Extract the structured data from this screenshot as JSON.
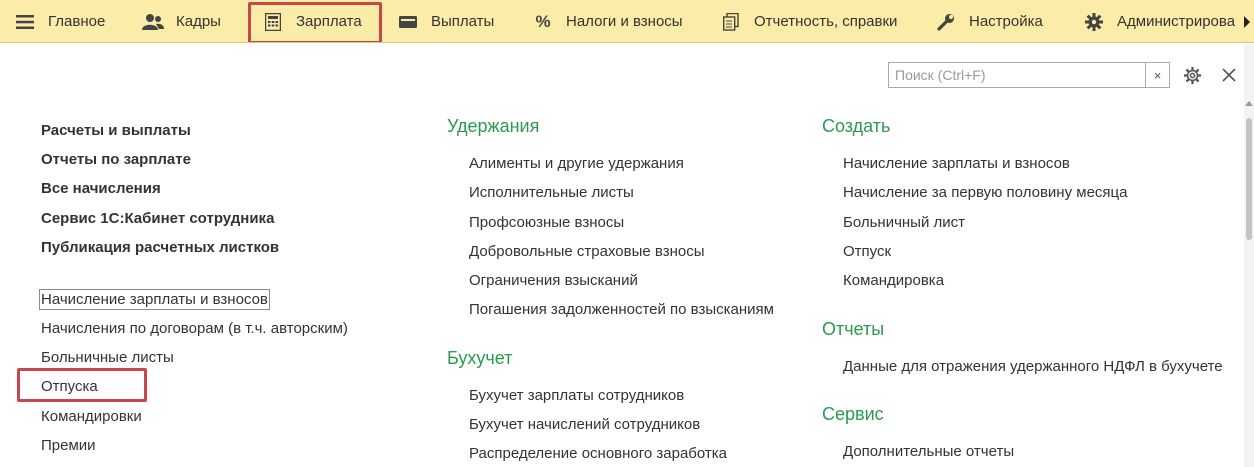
{
  "menu": {
    "tabs": [
      {
        "label": "Главное",
        "icon": "hamburger-icon"
      },
      {
        "label": "Кадры",
        "icon": "people-icon"
      },
      {
        "label": "Зарплата",
        "icon": "calculator-icon"
      },
      {
        "label": "Выплаты",
        "icon": "wallet-icon"
      },
      {
        "label": "Налоги и взносы",
        "icon": "percent-icon"
      },
      {
        "label": "Отчетность, справки",
        "icon": "documents-icon"
      },
      {
        "label": "Настройка",
        "icon": "wrench-icon"
      },
      {
        "label": "Администрирова",
        "icon": "gear-icon"
      }
    ],
    "percent_glyph": "%"
  },
  "search": {
    "placeholder": "Поиск (Ctrl+F)",
    "value": "",
    "clear_glyph": "×"
  },
  "close_glyph": "✕",
  "left": {
    "bold_links": [
      "Расчеты и выплаты",
      "Отчеты по зарплате",
      "Все начисления",
      "Сервис 1С:Кабинет сотрудника",
      "Публикация расчетных листков"
    ],
    "links": [
      "Начисление зарплаты и взносов",
      "Начисления по договорам (в т.ч. авторским)",
      "Больничные листы",
      "Отпуска",
      "Командировки",
      "Премии"
    ]
  },
  "middle": {
    "sections": [
      {
        "title": "Удержания",
        "items": [
          "Алименты и другие удержания",
          "Исполнительные листы",
          "Профсоюзные взносы",
          "Добровольные страховые взносы",
          "Ограничения взысканий",
          "Погашения задолженностей по взысканиям"
        ]
      },
      {
        "title": "Бухучет",
        "items": [
          "Бухучет зарплаты сотрудников",
          "Бухучет начислений сотрудников",
          "Распределение основного заработка"
        ]
      }
    ]
  },
  "right": {
    "sections": [
      {
        "title": "Создать",
        "items": [
          "Начисление зарплаты и взносов",
          "Начисление за первую половину месяца",
          "Больничный лист",
          "Отпуск",
          "Командировка"
        ]
      },
      {
        "title": "Отчеты",
        "items": [
          "Данные для отражения удержанного НДФЛ в бухучете"
        ]
      },
      {
        "title": "Сервис",
        "items": [
          "Дополнительные отчеты"
        ]
      }
    ]
  },
  "colors": {
    "accent_green": "#2a9a4f",
    "menu_bg": "#fbeda7",
    "highlight_red": "#c7484a"
  }
}
